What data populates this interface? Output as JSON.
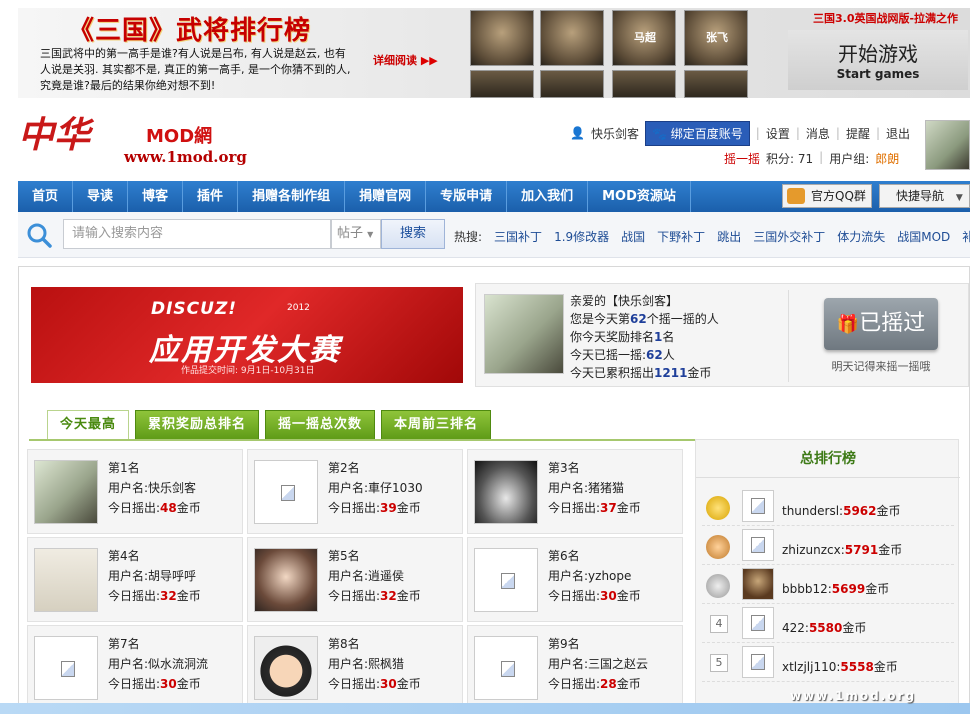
{
  "banner": {
    "title": "《三国》武将排行榜",
    "desc": "三国武将中的第一高手是谁?有人说是吕布, 有人说是赵云, 也有人说是关羽. 其实都不是, 真正的第一高手, 是一个你猜不到的人, 究竟是谁?最后的结果你绝对想不到!",
    "more": "详细阅读",
    "generals": [
      "",
      "",
      "马超",
      "张飞"
    ],
    "start_cn": "开始游戏",
    "start_en": "Start games",
    "ad": "三国3.0英国战网版-拉满之作"
  },
  "logo": {
    "cn": "中华",
    "mod": "MOD網",
    "url": "www.1mod.org"
  },
  "userbar": {
    "username": "快乐剑客",
    "bind": "绑定百度账号",
    "links": [
      "设置",
      "消息",
      "提醒",
      "退出"
    ],
    "shake": "摇一摇",
    "points": "积分: 71",
    "group_label": "用户组:",
    "group": "郎朗"
  },
  "nav": {
    "items": [
      "首页",
      "导读",
      "博客",
      "插件",
      "捐赠各制作组",
      "捐赠官网",
      "专版申请",
      "加入我们",
      "MOD资源站"
    ],
    "qq": "官方QQ群",
    "quick": "快捷导航"
  },
  "search": {
    "placeholder": "请输入搜索内容",
    "type": "帖子",
    "button": "搜索",
    "hot_label": "热搜:",
    "hot": [
      "三国补丁",
      "1.9修改器",
      "战国",
      "下野补丁",
      "跳出",
      "三国外交补丁",
      "体力流失",
      "战国MOD",
      "补丁"
    ]
  },
  "contest": {
    "brand": "DISCUZ!",
    "year": "2012",
    "title": "应用开发大赛",
    "date": "作品提交时间: 9月1日-10月31日"
  },
  "me": {
    "l1": "亲爱的【快乐剑客】",
    "l2a": "您是今天第",
    "l2b": "62",
    "l2c": "个摇一摇的人",
    "l3a": "你今天奖励排名",
    "l3b": "1",
    "l3c": "名",
    "l4a": "今天已摇一摇:",
    "l4b": "62",
    "l4c": "人",
    "l5a": "今天已累积摇出",
    "l5b": "1211",
    "l5c": "金币",
    "button": "已摇过",
    "hint": "明天记得来摇一摇哦"
  },
  "tabs": [
    "今天最高",
    "累积奖励总排名",
    "摇一摇总次数",
    "本周前三排名"
  ],
  "labels": {
    "user": "用户名:",
    "today": "今日摇出:",
    "coin": "金币"
  },
  "ranks": [
    {
      "rank": "第1名",
      "name": "快乐剑客",
      "amount": "48"
    },
    {
      "rank": "第2名",
      "name": "車仔1030",
      "amount": "39"
    },
    {
      "rank": "第3名",
      "name": "猪猪猫",
      "amount": "37"
    },
    {
      "rank": "第4名",
      "name": "胡导呼呼",
      "amount": "32"
    },
    {
      "rank": "第5名",
      "name": "逍遥侯",
      "amount": "32"
    },
    {
      "rank": "第6名",
      "name": "yzhope",
      "amount": "30"
    },
    {
      "rank": "第7名",
      "name": "似水流洞流",
      "amount": "30"
    },
    {
      "rank": "第8名",
      "name": "熙枫猎",
      "amount": "30"
    },
    {
      "rank": "第9名",
      "name": "三国之赵云",
      "amount": "28"
    }
  ],
  "leaderboard": {
    "title": "总排行榜",
    "rows": [
      {
        "name": "thundersl:",
        "amount": "5962",
        "num": "1"
      },
      {
        "name": "zhizunzcx:",
        "amount": "5791",
        "num": "2"
      },
      {
        "name": "bbbb12:",
        "amount": "5699",
        "num": "3"
      },
      {
        "name": "422:",
        "amount": "5580",
        "num": "4"
      },
      {
        "name": "xtlzjlj110:",
        "amount": "5558",
        "num": "5"
      }
    ]
  },
  "footer": {
    "url": "www.1mod.org"
  },
  "colors": {
    "nav": "#1b5fab",
    "tab": "#5d9a16",
    "accent": "#c00000"
  }
}
